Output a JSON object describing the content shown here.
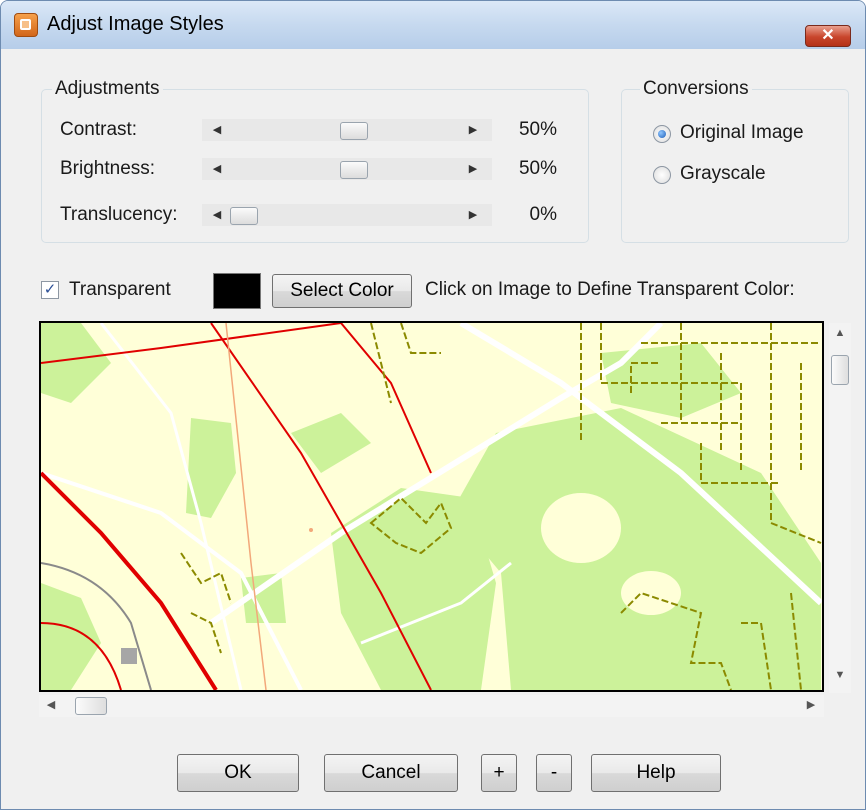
{
  "window": {
    "title": "Adjust Image Styles",
    "close_label": "✕"
  },
  "adjustments": {
    "group_label": "Adjustments",
    "sliders": [
      {
        "label": "Contrast:",
        "value_text": "50%",
        "value": 0.5
      },
      {
        "label": "Brightness:",
        "value_text": "50%",
        "value": 0.5
      },
      {
        "label": "Translucency:",
        "value_text": "0%",
        "value": 0.0
      }
    ]
  },
  "conversions": {
    "group_label": "Conversions",
    "options": [
      {
        "label": "Original Image",
        "selected": true
      },
      {
        "label": "Grayscale",
        "selected": false
      }
    ]
  },
  "transparency": {
    "checkbox_label": "Transparent",
    "checked": true,
    "swatch_color": "#000000",
    "select_color_label": "Select Color",
    "instruction": "Click on Image to Define Transparent Color:"
  },
  "map": {
    "colors": {
      "background": "#ffffd8",
      "park": "#ccf29a",
      "road": "#ffffff",
      "highway": "#e00000",
      "path": "#8b8a00",
      "minor_red": "#f2a87a"
    }
  },
  "buttons": {
    "ok": "OK",
    "cancel": "Cancel",
    "plus": "+",
    "minus": "-",
    "help": "Help"
  },
  "icons": {
    "app": "app-image-icon",
    "close": "close-icon"
  }
}
